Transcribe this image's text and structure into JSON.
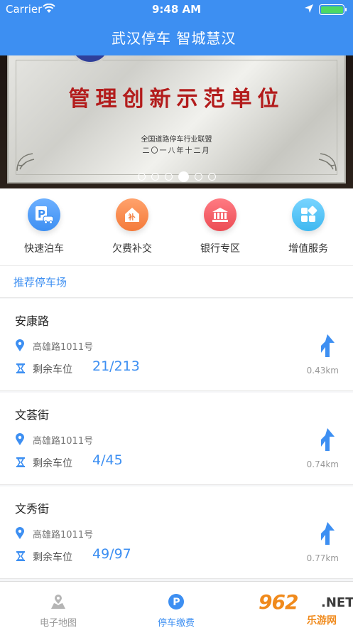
{
  "status": {
    "carrier": "Carrier",
    "time": "9:48 AM"
  },
  "nav": {
    "title": "武汉停车    智城慧汉"
  },
  "banner": {
    "plaque_title": "管理创新示范单位",
    "plaque_org": "全国道路停车行业联盟",
    "plaque_date": "二〇一八年十二月",
    "page_count": 6,
    "active_page": 4
  },
  "quick_actions": [
    {
      "label": "快速泊车",
      "icon": "parking-car-icon",
      "color": "#3d8ff2"
    },
    {
      "label": "欠费补交",
      "icon": "payment-house-icon",
      "color": "#f47a3a"
    },
    {
      "label": "银行专区",
      "icon": "bank-icon",
      "color": "#ec4d55"
    },
    {
      "label": "增值服务",
      "icon": "grid-icon",
      "color": "#3fb8f0"
    }
  ],
  "section": {
    "title": "推荐停车场"
  },
  "lots": [
    {
      "name": "安康路",
      "address": "高雄路1011号",
      "spaces_label": "剩余车位",
      "spaces": "21/213",
      "distance": "0.43km"
    },
    {
      "name": "文荟街",
      "address": "高雄路1011号",
      "spaces_label": "剩余车位",
      "spaces": "4/45",
      "distance": "0.74km"
    },
    {
      "name": "文秀街",
      "address": "高雄路1011号",
      "spaces_label": "剩余车位",
      "spaces": "49/97",
      "distance": "0.77km"
    }
  ],
  "tabs": [
    {
      "label": "电子地图",
      "icon": "map-icon"
    },
    {
      "label": "停车缴费",
      "icon": "parking-icon"
    }
  ],
  "watermark": {
    "brand": "962",
    "net": ".NET",
    "cn": "乐游网"
  },
  "colors": {
    "primary": "#3d8ff2"
  }
}
